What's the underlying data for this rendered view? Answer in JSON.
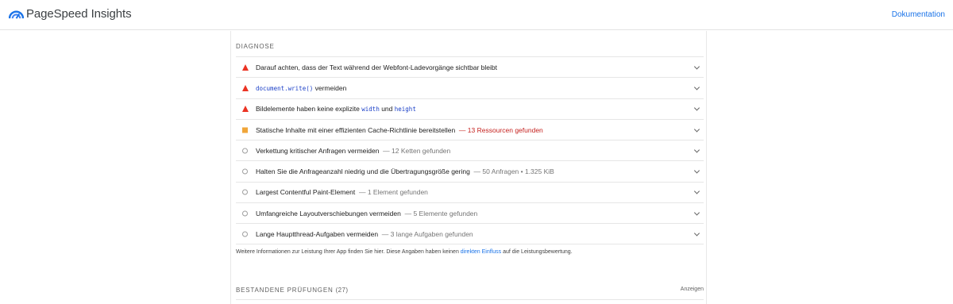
{
  "header": {
    "brand": "PageSpeed Insights",
    "doc_link": "Dokumentation",
    "logo_icon": "pagespeed-gauge-icon",
    "accent": "#1a73e8"
  },
  "diagnostics": {
    "section_title": "DIAGNOSE",
    "audits": [
      {
        "status": "fail",
        "parts": [
          {
            "text": "Darauf achten, dass der Text während der Webfont-Ladevorgänge sichtbar bleibt"
          }
        ],
        "detail": ""
      },
      {
        "status": "fail",
        "parts": [
          {
            "text": "document.write()",
            "code": true
          },
          {
            "text": " vermeiden"
          }
        ],
        "detail": ""
      },
      {
        "status": "fail",
        "parts": [
          {
            "text": "Bildelemente haben keine explizite "
          },
          {
            "text": "width",
            "code": true
          },
          {
            "text": " und "
          },
          {
            "text": "height",
            "code": true
          }
        ],
        "detail": ""
      },
      {
        "status": "average",
        "parts": [
          {
            "text": "Statische Inhalte mit einer effizienten Cache-Richtlinie bereitstellen"
          }
        ],
        "detail": "13 Ressourcen gefunden"
      },
      {
        "status": "info",
        "parts": [
          {
            "text": "Verkettung kritischer Anfragen vermeiden"
          }
        ],
        "detail": "12 Ketten gefunden"
      },
      {
        "status": "info",
        "parts": [
          {
            "text": "Halten Sie die Anfrageanzahl niedrig und die Übertragungsgröße gering"
          }
        ],
        "detail": "50 Anfragen • 1.325 KiB"
      },
      {
        "status": "info",
        "parts": [
          {
            "text": "Largest Contentful Paint-Element"
          }
        ],
        "detail": "1 Element gefunden"
      },
      {
        "status": "info",
        "parts": [
          {
            "text": "Umfangreiche Layoutverschiebungen vermeiden"
          }
        ],
        "detail": "5 Elemente gefunden"
      },
      {
        "status": "info",
        "parts": [
          {
            "text": "Lange Hauptthread-Aufgaben vermeiden"
          }
        ],
        "detail": "3 lange Aufgaben gefunden"
      }
    ],
    "note_before": "Weitere Informationen zur Leistung Ihrer App finden Sie hier. Diese Angaben haben keinen ",
    "note_link": "direkten Einfluss",
    "note_after": " auf die Leistungsbewertung."
  },
  "passed": {
    "title": "BESTANDENE PRÜFUNGEN",
    "count": "(27)",
    "show_label": "Anzeigen"
  },
  "colors": {
    "fail": "#eb3323",
    "average": "#f0a63a",
    "warn_detail": "#c5221f"
  }
}
